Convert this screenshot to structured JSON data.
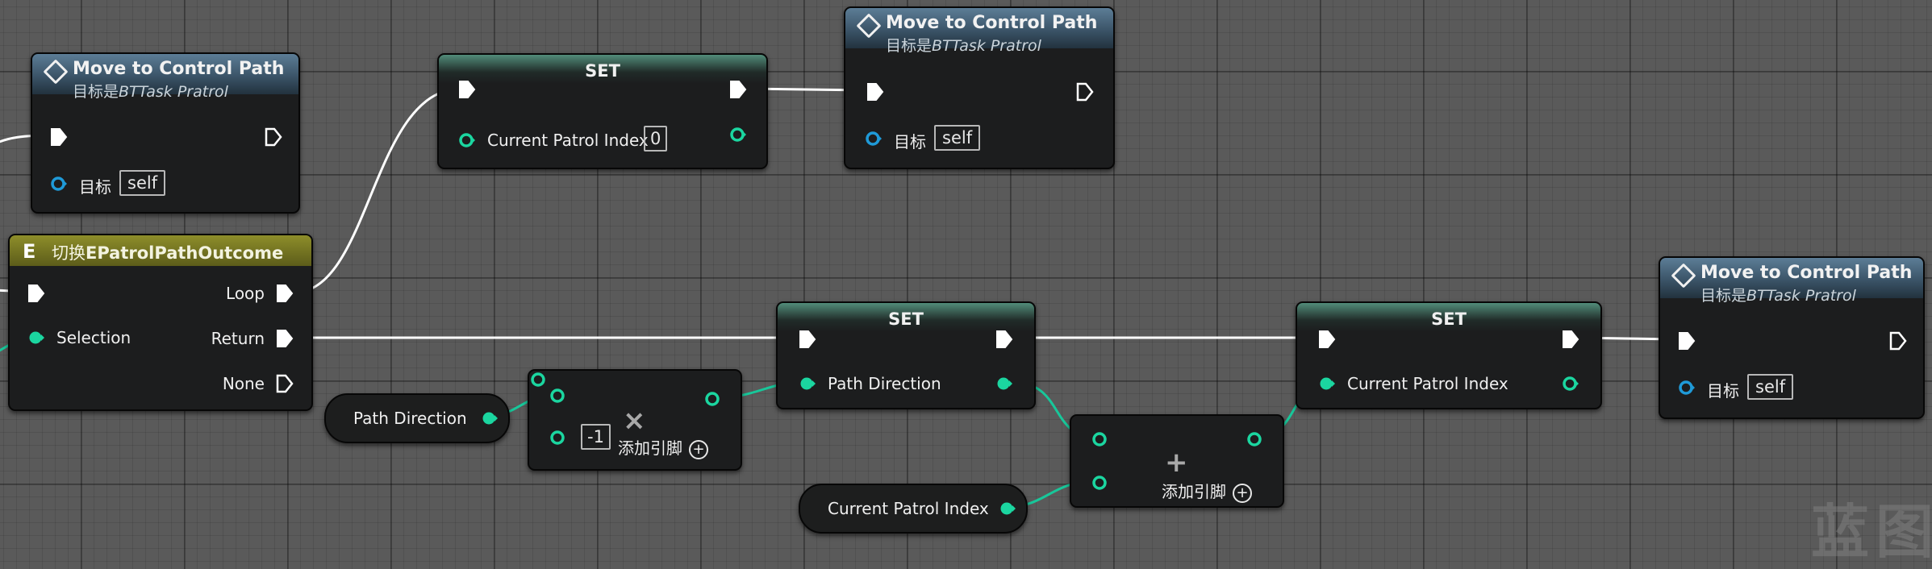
{
  "colors": {
    "exec": "#ffffff",
    "data_pin": "#1bd6a0",
    "object_pin": "#1f9ad8",
    "wire_data": "#18c79a"
  },
  "move_node_1": {
    "title": "Move to Control Path",
    "subtitle_prefix": "目标是",
    "subtitle_class": "BTTask Pratrol",
    "target_label": "目标",
    "target_value": "self"
  },
  "move_node_2": {
    "title": "Move to Control Path",
    "subtitle_prefix": "目标是",
    "subtitle_class": "BTTask Pratrol",
    "target_label": "目标",
    "target_value": "self"
  },
  "move_node_3": {
    "title": "Move to Control Path",
    "subtitle_prefix": "目标是",
    "subtitle_class": "BTTask Pratrol",
    "target_label": "目标",
    "target_value": "self"
  },
  "set_node_1": {
    "title": "SET",
    "var_label": "Current Patrol Index",
    "value": "0"
  },
  "set_node_2": {
    "title": "SET",
    "var_label": "Path Direction"
  },
  "set_node_3": {
    "title": "SET",
    "var_label": "Current Patrol Index"
  },
  "switch_node": {
    "title_prefix": "切换",
    "title_enum": "EPatrolPathOutcome",
    "icon": "E",
    "selection_label": "Selection",
    "outputs": [
      "Loop",
      "Return",
      "None"
    ]
  },
  "var_path_direction": {
    "label": "Path Direction"
  },
  "var_current_patrol_index": {
    "label": "Current Patrol Index"
  },
  "multiply_node": {
    "symbol": "×",
    "input_value": "-1",
    "add_pin_label": "添加引脚"
  },
  "add_node": {
    "symbol": "+",
    "add_pin_label": "添加引脚"
  },
  "watermark": {
    "text": "蓝图"
  }
}
